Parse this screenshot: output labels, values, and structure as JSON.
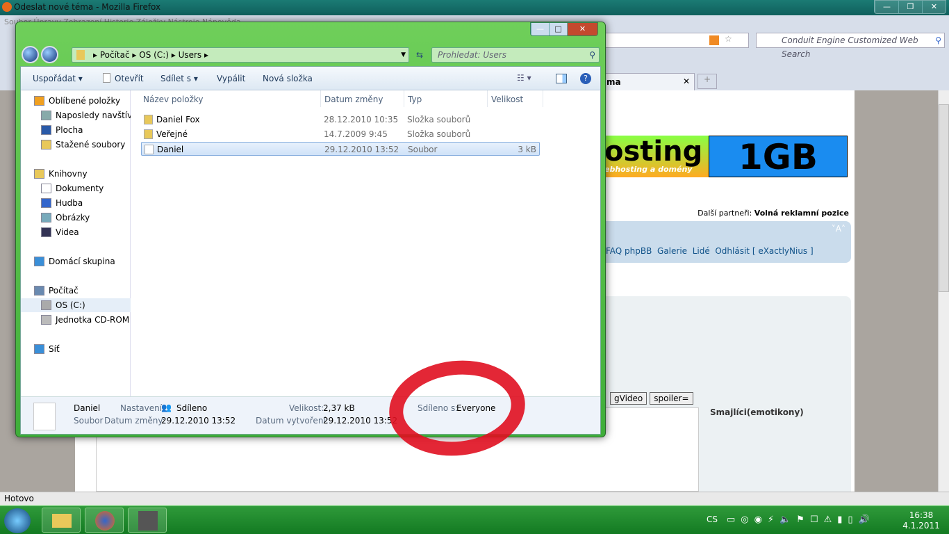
{
  "firefox": {
    "title": "Odeslat nové téma - Mozilla Firefox",
    "menu": "Soubor  Úpravy  Zobrazení  Historie  Záložky  Nástroje  Nápověda",
    "search_placeholder": "Conduit Engine Customized Web Search",
    "tab_label": "ma",
    "status": "Hotovo"
  },
  "page": {
    "banner_text": "osting",
    "banner_sub": "ebhosting a domény",
    "banner_big": "1GB",
    "partners_label": "Další partneři:",
    "partners_value": "Volná reklamní pozice",
    "font_ctrl": "˅A˄",
    "nav_links": [
      "FAQ phpBB",
      "Galerie",
      "Lidé",
      "Odhlásit [ eXactlyNius ]"
    ],
    "buttons": [
      "gVideo",
      "spoiler="
    ],
    "smileys_title": "Smajlíci(emotikony)"
  },
  "explorer": {
    "address": [
      "Počítač",
      "OS (C:)",
      "Users"
    ],
    "search_placeholder": "Prohledat: Users",
    "toolbar": {
      "organize": "Uspořádat ▾",
      "open": "Otevřít",
      "share": "Sdílet s ▾",
      "burn": "Vypálit",
      "new_folder": "Nová složka"
    },
    "nav": [
      {
        "label": "Oblíbené položky",
        "type": "header",
        "icon": "star"
      },
      {
        "label": "Naposledy navštívené",
        "icon": "recent"
      },
      {
        "label": "Plocha",
        "icon": "desktop"
      },
      {
        "label": "Stažené soubory",
        "icon": "downloads"
      },
      {
        "label": "Knihovny",
        "type": "header",
        "icon": "library"
      },
      {
        "label": "Dokumenty",
        "icon": "documents"
      },
      {
        "label": "Hudba",
        "icon": "music"
      },
      {
        "label": "Obrázky",
        "icon": "pictures"
      },
      {
        "label": "Videa",
        "icon": "videos"
      },
      {
        "label": "Domácí skupina",
        "type": "header",
        "icon": "homegroup"
      },
      {
        "label": "Počítač",
        "type": "header",
        "icon": "computer"
      },
      {
        "label": "OS (C:)",
        "icon": "drive",
        "selected": true
      },
      {
        "label": "Jednotka CD-ROM (D:)",
        "icon": "cdrom"
      },
      {
        "label": "Síť",
        "type": "header",
        "icon": "network"
      }
    ],
    "columns": [
      "Název položky",
      "Datum změny",
      "Typ",
      "Velikost"
    ],
    "files": [
      {
        "name": "Daniel Fox",
        "date": "28.12.2010 10:35",
        "type": "Složka souborů",
        "size": "",
        "icon": "locked-folder"
      },
      {
        "name": "Veřejné",
        "date": "14.7.2009 9:45",
        "type": "Složka souborů",
        "size": "",
        "icon": "folder"
      },
      {
        "name": "Daniel",
        "date": "29.12.2010 13:52",
        "type": "Soubor",
        "size": "3 kB",
        "icon": "file",
        "selected": true
      }
    ],
    "details": {
      "name": "Daniel",
      "kind": "Soubor",
      "settings_label": "Nastavení:",
      "settings_value": "Sdíleno",
      "modified_label": "Datum změny:",
      "modified_value": "29.12.2010 13:52",
      "size_label": "Velikost:",
      "size_value": "2,37 kB",
      "created_label": "Datum vytvoření:",
      "created_value": "29.12.2010 13:52",
      "shared_label": "Sdíleno s:",
      "shared_value": "Everyone"
    }
  },
  "taskbar": {
    "lang": "CS",
    "time": "16:38",
    "date": "4.1.2011"
  },
  "colors": {
    "aero_green": "#4fbf44",
    "taskbar": "#1f8a2e",
    "annotation": "#e01020"
  }
}
